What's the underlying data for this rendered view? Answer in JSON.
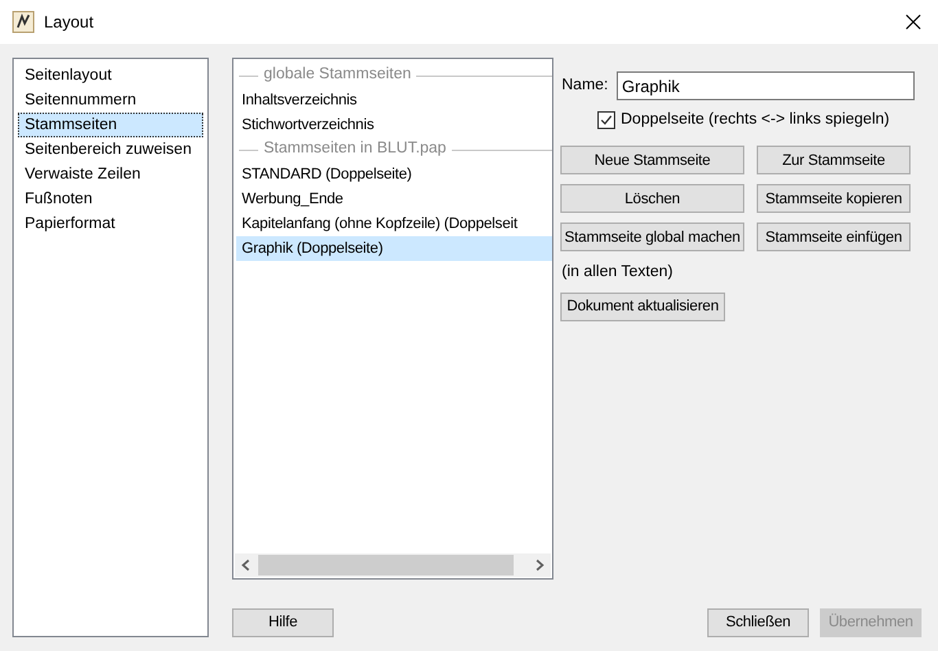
{
  "window": {
    "title": "Layout"
  },
  "categories": [
    {
      "label": "Seitenlayout",
      "selected": false
    },
    {
      "label": "Seitennummern",
      "selected": false
    },
    {
      "label": "Stammseiten",
      "selected": true
    },
    {
      "label": "Seitenbereich zuweisen",
      "selected": false
    },
    {
      "label": "Verwaiste Zeilen",
      "selected": false
    },
    {
      "label": "Fußnoten",
      "selected": false
    },
    {
      "label": "Papierformat",
      "selected": false
    }
  ],
  "master_pages": [
    {
      "kind": "header",
      "label": "globale Stammseiten"
    },
    {
      "kind": "item",
      "label": "Inhaltsverzeichnis",
      "selected": false
    },
    {
      "kind": "item",
      "label": "Stichwortverzeichnis",
      "selected": false
    },
    {
      "kind": "header",
      "label": "Stammseiten in BLUT.pap"
    },
    {
      "kind": "item",
      "label": "STANDARD (Doppelseite)",
      "selected": false
    },
    {
      "kind": "item",
      "label": "Werbung_Ende",
      "selected": false
    },
    {
      "kind": "item",
      "label": "Kapitelanfang (ohne Kopfzeile) (Doppelseit",
      "selected": false
    },
    {
      "kind": "item",
      "label": "Graphik (Doppelseite)",
      "selected": true
    }
  ],
  "name_field": {
    "label": "Name:",
    "value": "Graphik"
  },
  "double_page": {
    "label": "Doppelseite (rechts <-> links spiegeln)",
    "checked": true
  },
  "action_buttons": [
    [
      "Neue Stammseite",
      "Zur Stammseite"
    ],
    [
      "Löschen",
      "Stammseite kopieren"
    ],
    [
      "Stammseite global machen",
      "Stammseite einfügen"
    ]
  ],
  "note": "(in allen Texten)",
  "update_button": "Dokument aktualisieren",
  "footer_buttons": [
    {
      "label": "Hilfe",
      "disabled": false
    },
    {
      "label": "Schließen",
      "disabled": false
    },
    {
      "label": "Übernehmen",
      "disabled": true
    }
  ]
}
